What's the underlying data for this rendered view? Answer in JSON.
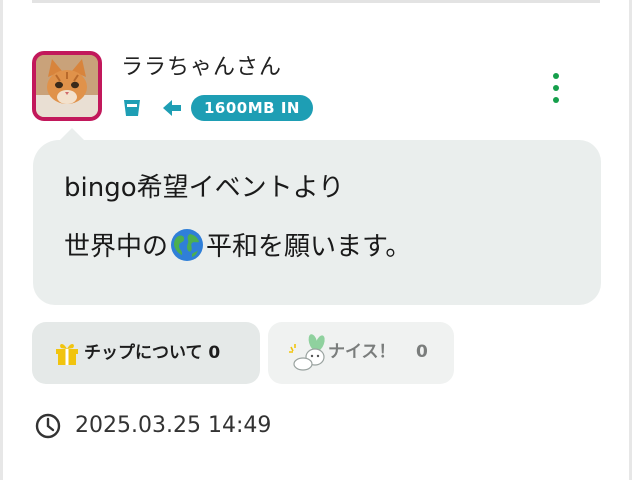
{
  "post": {
    "username": "ララちゃんさん",
    "data_badge": "1600MB IN",
    "message_line1": "bingo希望イベントより",
    "message_line2_before": "世界中の",
    "message_line2_after": "平和を願います。",
    "timestamp": "2025.03.25 14:49"
  },
  "actions": {
    "tip_label": "チップについて 0",
    "nice_label": "ナイス！",
    "nice_count": "0"
  },
  "icons": {
    "avatar": "cat-avatar",
    "status": "cup-icon",
    "direction": "arrow-left-icon",
    "more": "more-vertical-icon",
    "inline_emoji": "globe-icon",
    "tip": "gift-icon",
    "nice": "nice-character-icon",
    "time": "clock-icon"
  },
  "colors": {
    "avatar_border": "#c2185b",
    "accent_teal": "#1e9eb4",
    "more_dots": "#159f4b",
    "bubble_bg": "#eaeeed",
    "tip_bg": "#e5e9e8",
    "nice_bg": "#f0f2f1"
  }
}
